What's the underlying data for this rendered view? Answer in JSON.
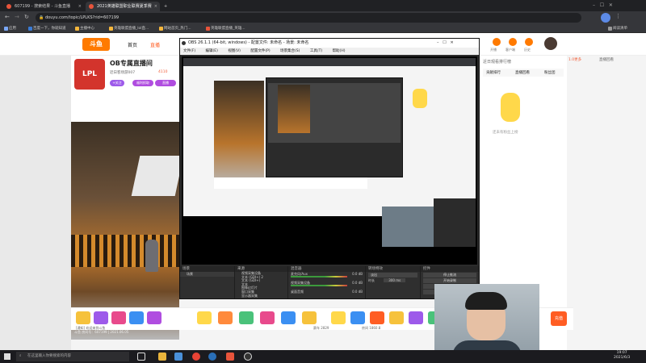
{
  "browser": {
    "tabs": [
      {
        "label": "607199 - 搜索结果 - 斗鱼直播",
        "active": false
      },
      {
        "label": "2021英雄联盟职业联赛夏季赛",
        "active": true
      },
      {
        "label": "",
        "active": false
      }
    ],
    "url": "douyu.com/topic/LPLKS?rid=607199",
    "bookmarks": [
      "应用",
      "百度一下，你就知道",
      "主播中心",
      "英雄联盟直播_lol直...",
      "网站首页_热门...",
      "英雄联盟直播_英雄...",
      "阅读清单"
    ]
  },
  "site": {
    "logo_text": "斗鱼",
    "nav": [
      "首页",
      "直播"
    ],
    "room_title": "OB专属直播间",
    "room_tag": "LPL",
    "room_sub": "近日客场游007",
    "room_count": "4110",
    "follow_label": "+关注",
    "badges": [
      "福利抓取",
      "直播"
    ],
    "video_caption": "斗鱼 房间号：607199 | 2021.06.05",
    "bottom_left": "[通知] 欢迎来到斗鱼",
    "bottom_stats": [
      "赛车 2829",
      "房间 1860.8"
    ],
    "bottom_button": "充值",
    "right_top_icons": [
      "开播",
      "客户端",
      "历史"
    ],
    "right_tabs": [
      "贡献排行",
      "直播回看",
      "粉丝团"
    ],
    "right_side_text": "近日观看排行榜",
    "right_mascot_caption": "还未有粉丝上榜",
    "right_edge_labels": [
      "1.0更多",
      "直播回看"
    ]
  },
  "obs": {
    "title": "OBS 26.1.1 (64-bit, windows) - 配置文件: 未命名 - 场景: 未命名",
    "menu": [
      "文件(F)",
      "编辑(E)",
      "视图(V)",
      "配置文件(P)",
      "场景集合(S)",
      "工具(T)",
      "帮助(H)"
    ],
    "docks": {
      "scenes": {
        "title": "场景",
        "items": [
          "场景"
        ]
      },
      "sources": {
        "title": "来源",
        "items": [
          "视频采集设备",
          "文本 (GDI+) 2",
          "文本 (GDI+)",
          "文本",
          "图像幻灯片",
          "窗口采集",
          "显示器采集"
        ]
      },
      "mixer": {
        "title": "混音器",
        "channels": [
          {
            "name": "麦克风/Aux",
            "level": "0.0 dB"
          },
          {
            "name": "视频采集设备",
            "level": "0.0 dB"
          },
          {
            "name": "桌面音频",
            "level": "0.0 dB"
          }
        ]
      },
      "transitions": {
        "title": "转场特效",
        "type": "淡出",
        "duration_label": "时长",
        "duration": "300 ms"
      },
      "controls": {
        "title": "控件",
        "buttons": [
          "停止推流",
          "开始录制",
          "启动虚拟摄像机",
          "工作室模式",
          "设置"
        ]
      }
    },
    "status": [
      "LIVE: 00:00:00",
      "REC: 00:00:00",
      "CPU: 1.8%, 30.00 fps"
    ]
  },
  "taskbar": {
    "search_placeholder": "在这里输入你要搜索的内容",
    "time": "19:07",
    "date": "2021/6/3"
  }
}
